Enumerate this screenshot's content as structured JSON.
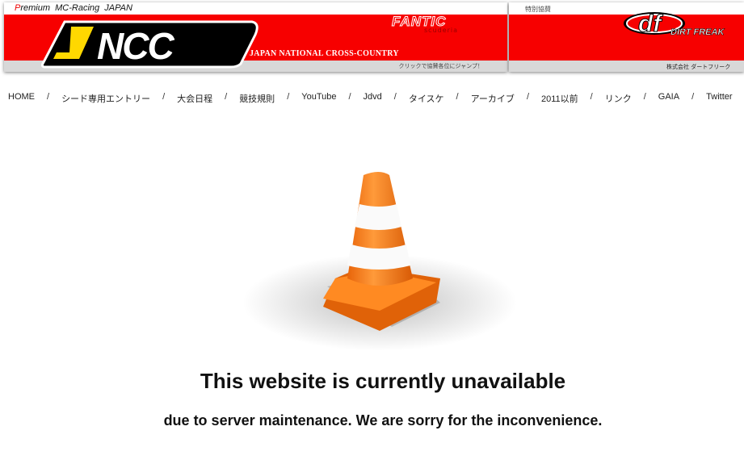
{
  "banner_main": {
    "tagline_first": "P",
    "tagline_rest": "remium  MC-Racing  JAPAN",
    "logo": "JNCC",
    "full_name": "JAPAN NATIONAL CROSS-COUNTRY",
    "sponsor_logo": "FANTIC",
    "sponsor_sub": "scuderia",
    "click_note": "クリックで協賛各位にジャンプ！"
  },
  "banner_sponsor": {
    "label": "特別協賛",
    "logo": "df",
    "logo_text": "DIRT FREAK",
    "company": "株式会社 ダートフリーク"
  },
  "nav": [
    "HOME",
    "シード専用エントリー",
    "大会日程",
    "競技規則",
    "YouTube",
    "Jdvd",
    "タイスケ",
    "アーカイブ",
    "2011以前",
    "リンク",
    "GAIA",
    "Twitter"
  ],
  "nav_separator": "/",
  "message": {
    "title": "This website is currently unavailable",
    "subtitle": "due to server maintenance. We are sorry for the inconvenience."
  },
  "colors": {
    "banner_red": "#f70000",
    "cone_orange": "#f77a12",
    "jncc_yellow": "#ffd800"
  },
  "icons": {
    "maintenance": "traffic-cone-icon"
  }
}
